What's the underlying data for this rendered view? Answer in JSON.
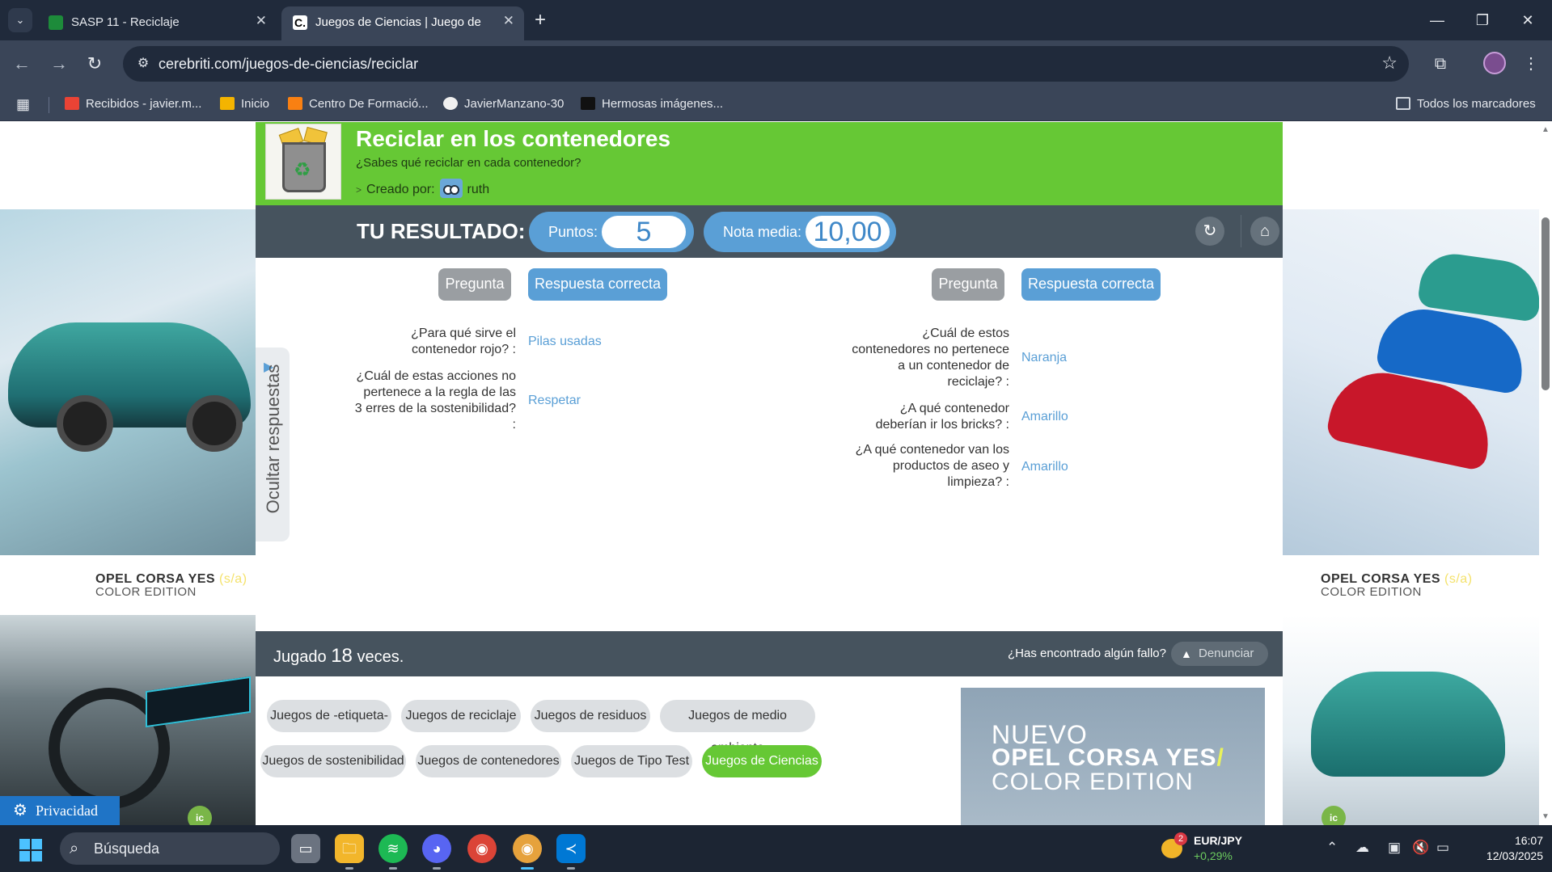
{
  "browser": {
    "tabs": [
      {
        "title": "SASP 11 - Reciclaje",
        "active": false
      },
      {
        "title": "Juegos de Ciencias | Juego de Reciclar",
        "favicon_letter": "C.",
        "active": true
      }
    ],
    "url": "cerebriti.com/juegos-de-ciencias/reciclar",
    "bookmarks": [
      {
        "label": "Recibidos - javier.m...",
        "icon": "gmail-icon"
      },
      {
        "label": "Inicio",
        "icon": "classroom-icon"
      },
      {
        "label": "Centro De Formació...",
        "icon": "moodle-icon"
      },
      {
        "label": "JavierManzano-30",
        "icon": "github-icon"
      },
      {
        "label": "Hermosas imágenes...",
        "icon": "image-site-icon"
      }
    ],
    "all_bookmarks": "Todos los marcadores"
  },
  "game": {
    "title": "Reciclar en los contenedores",
    "subtitle": "¿Sabes qué reciclar en cada contenedor?",
    "creator_label": "Creado por:",
    "creator_name": "ruth"
  },
  "result": {
    "label": "TU RESULTADO:",
    "points_label": "Puntos:",
    "points_value": "5",
    "avg_label": "Nota media:",
    "avg_value": "10,00"
  },
  "answers": {
    "question_header": "Pregunta",
    "answer_header": "Respuesta correcta",
    "hide_label": "Ocultar respuestas",
    "left": [
      {
        "q": "¿Para qué sirve el contenedor rojo? :",
        "a": "Pilas usadas"
      },
      {
        "q": "¿Cuál de estas acciones no pertenece a la regla de las 3 erres de la sostenibilidad? :",
        "a": "Respetar"
      }
    ],
    "right": [
      {
        "q": "¿Cuál de estos contenedores no pertenece a un contenedor de reciclaje? :",
        "a": "Naranja"
      },
      {
        "q": "¿A qué contenedor deberían ir los bricks? :",
        "a": "Amarillo"
      },
      {
        "q": "¿A qué contenedor van los productos de aseo y limpieza? :",
        "a": "Amarillo"
      }
    ]
  },
  "stats": {
    "played_prefix": "Jugado",
    "played_count": "18",
    "played_suffix": "veces.",
    "report_question": "¿Has encontrado algún fallo?",
    "report_button": "Denunciar"
  },
  "tags": [
    {
      "label": "Juegos de -etiqueta-",
      "active": false
    },
    {
      "label": "Juegos de reciclaje",
      "active": false
    },
    {
      "label": "Juegos de residuos",
      "active": false
    },
    {
      "label": "Juegos de medio ambiente",
      "active": false
    },
    {
      "label": "Juegos de sostenibilidad",
      "active": false
    },
    {
      "label": "Juegos de contenedores",
      "active": false
    },
    {
      "label": "Juegos de Tipo Test",
      "active": false
    },
    {
      "label": "Juegos de Ciencias",
      "active": true
    }
  ],
  "ads": {
    "brand_line": "OPEL CORSA YES",
    "brand_mark": "(s/a)",
    "brand_sub": "COLOR EDITION",
    "banner_l1": "NUEVO",
    "banner_l2": "OPEL CORSA YES",
    "banner_slash": "/",
    "banner_l3": "COLOR EDITION",
    "badge": "ic"
  },
  "privacy_label": "Privacidad",
  "taskbar": {
    "search_placeholder": "Búsqueda",
    "ticker_pair": "EUR/JPY",
    "ticker_change": "+0,29%",
    "ticker_badge": "2",
    "time": "16:07",
    "date": "12/03/2025"
  },
  "colors": {
    "brand_green": "#66c835",
    "header_slate": "#46535e",
    "accent_blue": "#5a9fd6",
    "browser_dark": "#202a3b"
  }
}
